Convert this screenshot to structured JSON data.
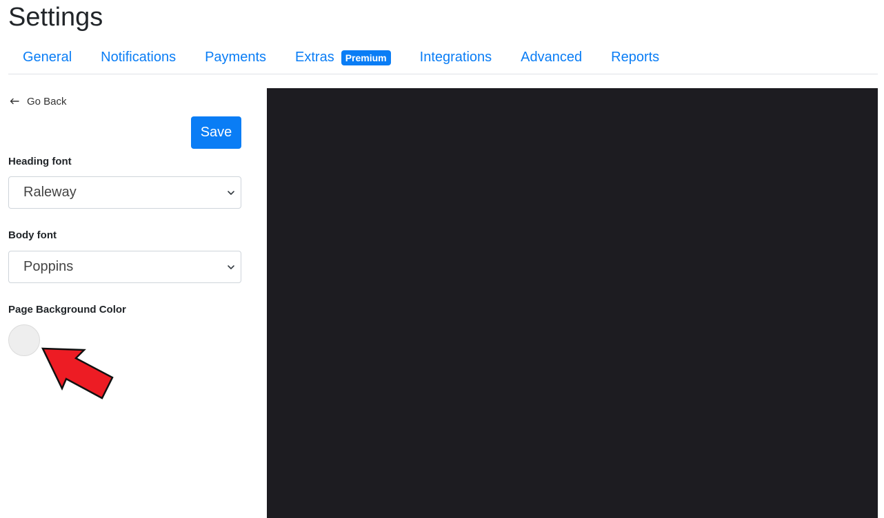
{
  "page": {
    "title": "Settings"
  },
  "tabs": [
    {
      "label": "General"
    },
    {
      "label": "Notifications"
    },
    {
      "label": "Payments"
    },
    {
      "label": "Extras",
      "badge": "Premium"
    },
    {
      "label": "Integrations"
    },
    {
      "label": "Advanced"
    },
    {
      "label": "Reports"
    }
  ],
  "panel": {
    "go_back_label": "Go Back",
    "go_back_icon": "arrow-left-icon",
    "save_label": "Save",
    "heading_font": {
      "label": "Heading font",
      "value": "Raleway"
    },
    "body_font": {
      "label": "Body font",
      "value": "Poppins"
    },
    "background_color": {
      "label": "Page Background Color",
      "value": "#eeeeee"
    }
  },
  "colors": {
    "accent": "#0a7df5",
    "preview_background": "#1d1c21",
    "annotation_arrow": "#ed1c24"
  }
}
